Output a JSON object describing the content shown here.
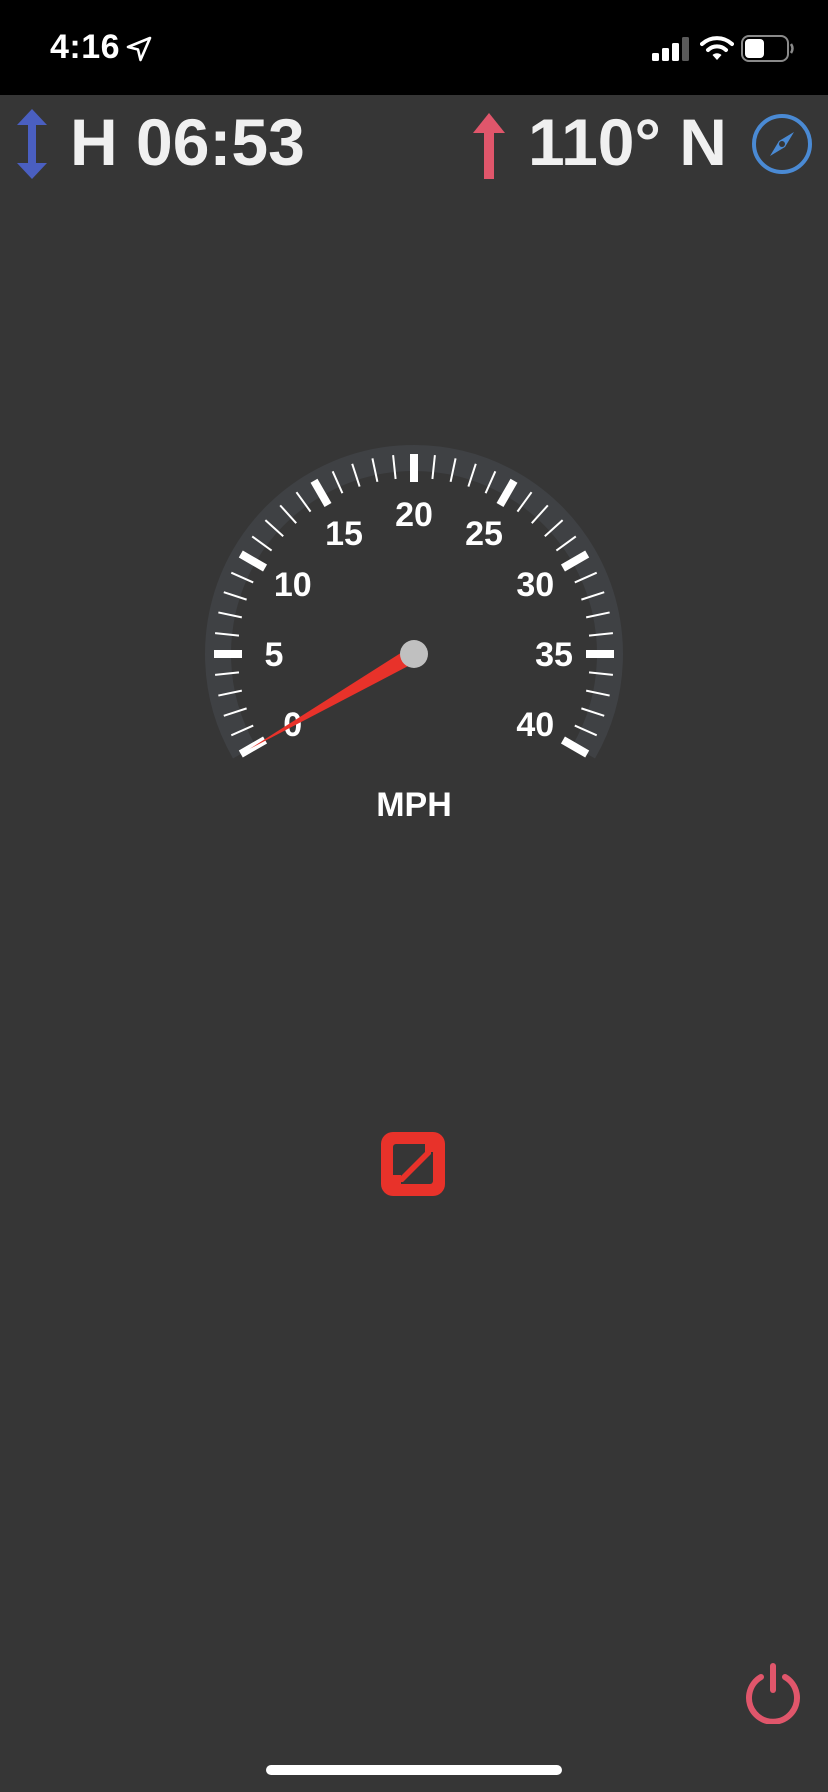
{
  "status_bar": {
    "time": "4:16",
    "icons": [
      "location-arrow-icon",
      "cellular-signal-icon",
      "wifi-icon",
      "battery-icon"
    ]
  },
  "top_row": {
    "heading_mode_icon": "up-down-arrow-icon",
    "heading_time": "H 06:53",
    "bearing_icon": "up-arrow-icon",
    "bearing": "110° N",
    "compass_icon": "compass-icon",
    "colors": {
      "heading_icon": "#4a5fc1",
      "bearing_icon": "#e0566b",
      "compass_icon": "#4a8ad4"
    }
  },
  "speedometer": {
    "unit": "MPH",
    "min": 0,
    "max": 40,
    "major_step": 5,
    "labels": [
      "0",
      "5",
      "10",
      "15",
      "20",
      "25",
      "30",
      "35",
      "40"
    ],
    "current_value": 0,
    "needle_color": "#e8322a",
    "hub_color": "#c0c0c0"
  },
  "controls": {
    "stop_icon": "stop-square-icon",
    "stop_color": "#e8322a",
    "power_icon": "power-icon",
    "power_color": "#e0566b"
  }
}
